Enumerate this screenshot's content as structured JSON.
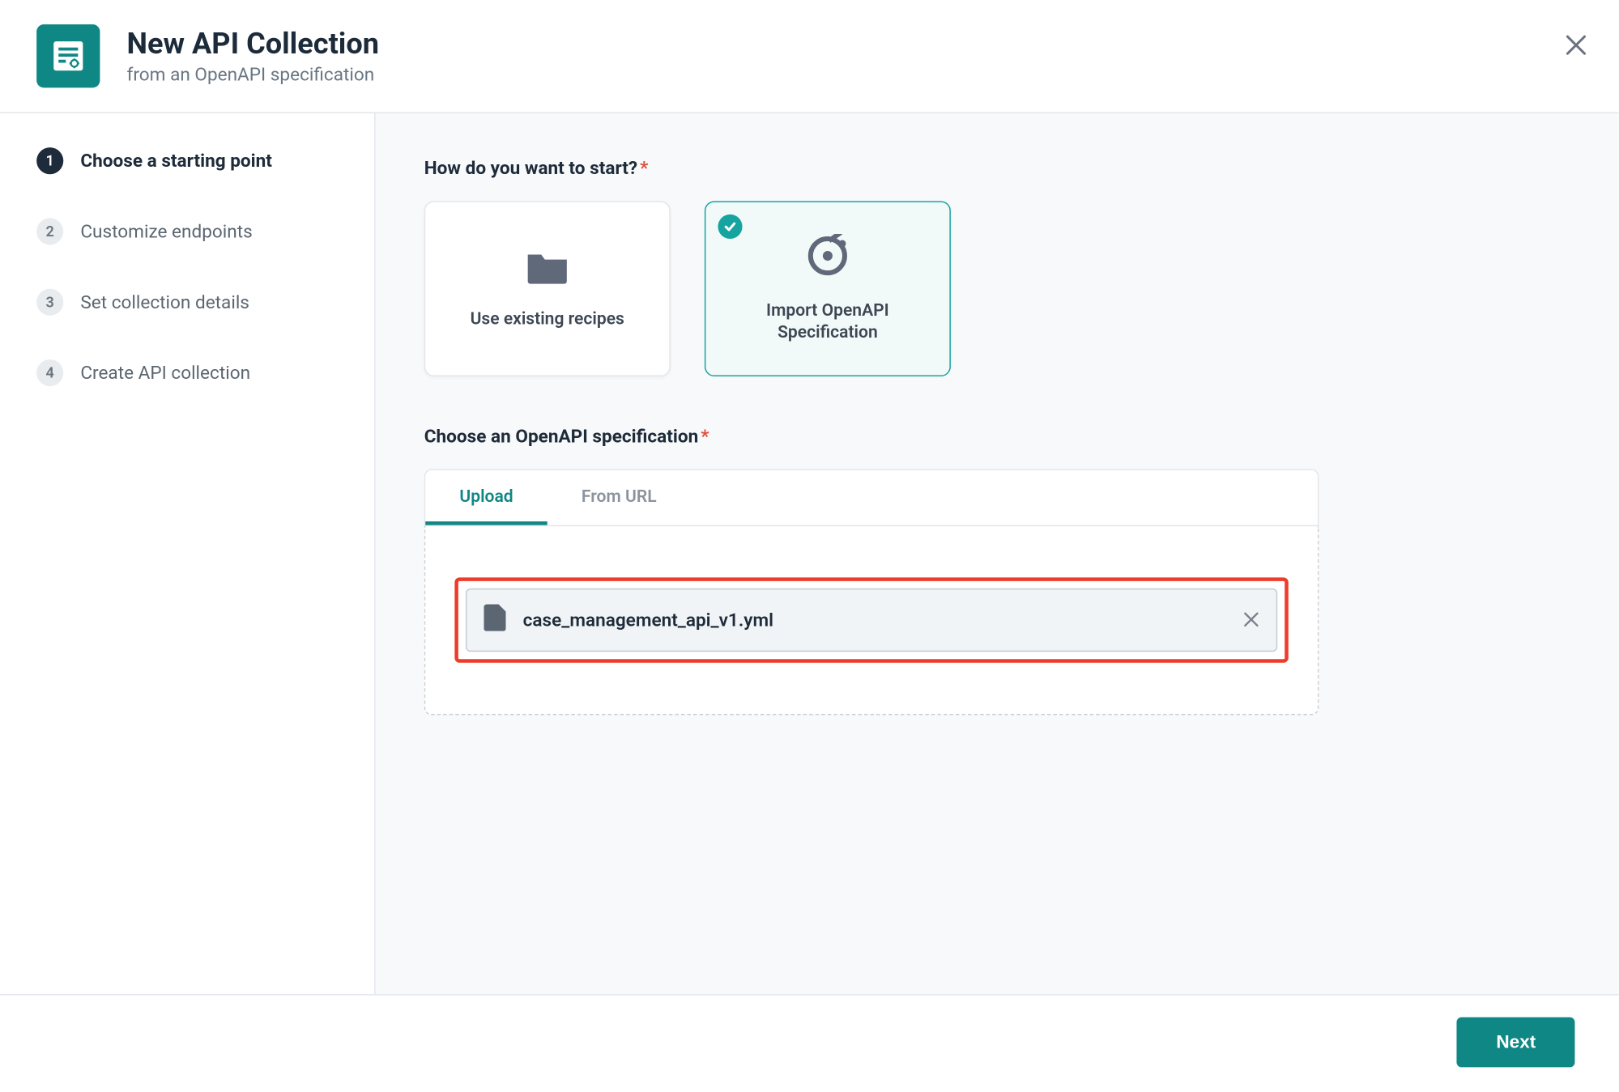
{
  "header": {
    "title": "New API Collection",
    "subtitle": "from an OpenAPI specification"
  },
  "sidebar": {
    "steps": [
      {
        "num": "1",
        "label": "Choose a starting point",
        "active": true
      },
      {
        "num": "2",
        "label": "Customize endpoints",
        "active": false
      },
      {
        "num": "3",
        "label": "Set collection details",
        "active": false
      },
      {
        "num": "4",
        "label": "Create API collection",
        "active": false
      }
    ]
  },
  "main": {
    "question1": "How do you want to start?",
    "cards": {
      "existing": "Use existing recipes",
      "import": "Import OpenAPI Specification"
    },
    "question2": "Choose an OpenAPI specification",
    "tabs": {
      "upload": "Upload",
      "from_url": "From URL"
    },
    "file": {
      "name": "case_management_api_v1.yml"
    }
  },
  "footer": {
    "next": "Next"
  }
}
